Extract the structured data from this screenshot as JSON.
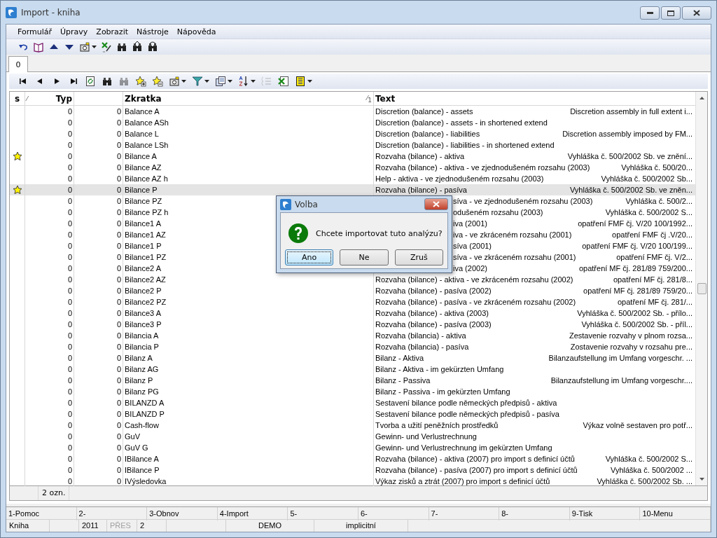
{
  "window": {
    "title": "Import - kniha"
  },
  "menu": [
    "Formulář",
    "Úpravy",
    "Zobrazit",
    "Nástroje",
    "Nápověda"
  ],
  "toolbar": [
    {
      "kind": "undo"
    },
    {
      "kind": "book"
    },
    {
      "kind": "up"
    },
    {
      "kind": "down"
    },
    {
      "kind": "camera",
      "dropdown": true
    },
    {
      "kind": "excel-pen"
    },
    {
      "kind": "binoculars"
    },
    {
      "kind": "binoculars-up"
    },
    {
      "kind": "binoculars-down"
    }
  ],
  "tabs": [
    {
      "label": "0",
      "selected": true
    }
  ],
  "grid_toolbar": [
    {
      "kind": "first"
    },
    {
      "kind": "prev"
    },
    {
      "kind": "next"
    },
    {
      "kind": "last"
    },
    {
      "kind": "refresh"
    },
    {
      "kind": "binoculars"
    },
    {
      "kind": "binoculars",
      "disabled": true
    },
    {
      "kind": "star-plus"
    },
    {
      "kind": "star-minus"
    },
    {
      "kind": "camera",
      "dropdown": true
    },
    {
      "kind": "filter",
      "dropdown": true
    },
    {
      "kind": "copy",
      "dropdown": true
    },
    {
      "kind": "sort",
      "dropdown": true
    },
    {
      "kind": "list",
      "disabled": true
    },
    {
      "kind": "excel"
    },
    {
      "kind": "table",
      "dropdown": true
    }
  ],
  "table": {
    "columns": [
      {
        "label": "s"
      },
      {
        "label": "Typ",
        "sort_mark": "⁄"
      },
      {},
      {
        "label": "Zkratka",
        "sort_mark": "⁄",
        "sort_index": "1"
      },
      {
        "label": "Text"
      }
    ],
    "rows": [
      {
        "marked": false,
        "selected": false,
        "typ": "0",
        "column_3": "0",
        "zkratka": "Balance A",
        "text": "Discretion (balance) - assets",
        "note": "Discretion assembly in full extent i..."
      },
      {
        "marked": false,
        "selected": false,
        "typ": "0",
        "column_3": "0",
        "zkratka": "Balance ASh",
        "text": "Discretion (balance) - assets - in shortened extend"
      },
      {
        "marked": false,
        "selected": false,
        "typ": "0",
        "column_3": "0",
        "zkratka": "Balance L",
        "text": "Discretion (balance) - liabilities",
        "note": "Discretion assembly imposed by FM..."
      },
      {
        "marked": false,
        "selected": false,
        "typ": "0",
        "column_3": "0",
        "zkratka": "Balance LSh",
        "text": "Discretion (balance) - liabilities - in shortened extend"
      },
      {
        "marked": true,
        "selected": false,
        "typ": "0",
        "column_3": "0",
        "zkratka": "Bilance A",
        "text": "Rozvaha (bilance) - aktiva",
        "note": "Vyhláška č. 500/2002 Sb. ve znění..."
      },
      {
        "marked": false,
        "selected": false,
        "typ": "0",
        "column_3": "0",
        "zkratka": "Bilance AZ",
        "text": "Rozvaha (bilance) - aktiva - ve zjednodušeném rozsahu (2003)",
        "note": "Vyhláška č. 500/20..."
      },
      {
        "marked": false,
        "selected": false,
        "typ": "0",
        "column_3": "0",
        "zkratka": "Bilance AZ h",
        "text": "Help - aktiva - ve zjednodušeném rozsahu (2003)",
        "note": "Vyhláška č. 500/2002 Sb..."
      },
      {
        "marked": true,
        "selected": true,
        "typ": "0",
        "column_3": "0",
        "zkratka": "Bilance P",
        "text": "Rozvaha (bilance) - pasíva",
        "note": "Vyhláška č. 500/2002 Sb. ve zněn..."
      },
      {
        "marked": false,
        "selected": false,
        "covered": true,
        "typ": "0",
        "column_3": "0",
        "zkratka": "Bilance PZ",
        "text": "síva - ve zjednodušeném rozsahu (2003)",
        "note": "Vyhláška č. 500/2..."
      },
      {
        "marked": false,
        "selected": false,
        "covered": true,
        "typ": "0",
        "column_3": "0",
        "zkratka": "Bilance PZ h",
        "text": "odušeném rozsahu (2003)",
        "note": "Vyhláška č. 500/2002 S..."
      },
      {
        "marked": false,
        "selected": false,
        "covered": true,
        "typ": "0",
        "column_3": "0",
        "zkratka": "Bilance1 A",
        "text": "iva (2001)",
        "note": "opatření FMF čj. V/20 100/1992..."
      },
      {
        "marked": false,
        "selected": false,
        "covered": true,
        "typ": "0",
        "column_3": "0",
        "zkratka": "Bilance1 AZ",
        "text": "iva - ve zkráceném rozsahu (2001)",
        "note": "opatření FMF čj .V/20..."
      },
      {
        "marked": false,
        "selected": false,
        "covered": true,
        "typ": "0",
        "column_3": "0",
        "zkratka": "Bilance1 P",
        "text": "síva (2001)",
        "note": "opatření FMF čj. V/20 100/199..."
      },
      {
        "marked": false,
        "selected": false,
        "covered": true,
        "typ": "0",
        "column_3": "0",
        "zkratka": "Bilance1 PZ",
        "text": "síva - ve zkráceném rozsahu (2001)",
        "note": "opatření FMF čj. V/2..."
      },
      {
        "marked": false,
        "selected": false,
        "covered": true,
        "typ": "0",
        "column_3": "0",
        "zkratka": "Bilance2 A",
        "text": "iva (2002)",
        "note": "opatření MF čj. 281/89 759/200..."
      },
      {
        "marked": false,
        "selected": false,
        "typ": "0",
        "column_3": "0",
        "zkratka": "Bilance2 AZ",
        "text": "Rozvaha (bilance) - aktiva - ve zkráceném rozsahu (2002)",
        "note": "opatření MF čj. 281/8..."
      },
      {
        "marked": false,
        "selected": false,
        "typ": "0",
        "column_3": "0",
        "zkratka": "Bilance2 P",
        "text": "Rozvaha (bilance) - pasíva (2002)",
        "note": "opatření MF čj. 281/89 759/20..."
      },
      {
        "marked": false,
        "selected": false,
        "typ": "0",
        "column_3": "0",
        "zkratka": "Bilance2 PZ",
        "text": "Rozvaha (bilance) - pasíva - ve zkráceném rozsahu (2002)",
        "note": "opatření MF čj. 281/..."
      },
      {
        "marked": false,
        "selected": false,
        "typ": "0",
        "column_3": "0",
        "zkratka": "Bilance3 A",
        "text": "Rozvaha (bilance) - aktiva (2003)",
        "note": "Vyhláška č. 500/2002 Sb. - přílo..."
      },
      {
        "marked": false,
        "selected": false,
        "typ": "0",
        "column_3": "0",
        "zkratka": "Bilance3 P",
        "text": "Rozvaha (bilance) - pasíva (2003)",
        "note": "Vyhláška č. 500/2002 Sb. - příl..."
      },
      {
        "marked": false,
        "selected": false,
        "typ": "0",
        "column_3": "0",
        "zkratka": "Bilancia A",
        "text": "Rozvaha (bilancia) - aktiva",
        "note": "Zestavenie rozvahy v plnom rozsa..."
      },
      {
        "marked": false,
        "selected": false,
        "typ": "0",
        "column_3": "0",
        "zkratka": "Bilancia P",
        "text": "Rozvaha (bilancia) - pasíva",
        "note": "Zostavenie rozvahy v rozsahu pre..."
      },
      {
        "marked": false,
        "selected": false,
        "typ": "0",
        "column_3": "0",
        "zkratka": "Bilanz A",
        "text": "Bilanz - Aktiva",
        "note": "Bilanzaufstellung im Umfang vorgeschr. ..."
      },
      {
        "marked": false,
        "selected": false,
        "typ": "0",
        "column_3": "0",
        "zkratka": "Bilanz AG",
        "text": "Bilanz - Aktiva - im gekürzten Umfang"
      },
      {
        "marked": false,
        "selected": false,
        "typ": "0",
        "column_3": "0",
        "zkratka": "Bilanz P",
        "text": "Bilanz - Passiva",
        "note": "Bilanzaufstellung im Umfang vorgeschr...."
      },
      {
        "marked": false,
        "selected": false,
        "typ": "0",
        "column_3": "0",
        "zkratka": "Bilanz PG",
        "text": "Bilanz - Passiva - im gekürzten Umfang"
      },
      {
        "marked": false,
        "selected": false,
        "typ": "0",
        "column_3": "0",
        "zkratka": "BILANZD A",
        "text": "Sestavení bilance podle německých předpisů - aktiva"
      },
      {
        "marked": false,
        "selected": false,
        "typ": "0",
        "column_3": "0",
        "zkratka": "BILANZD P",
        "text": "Sestavení bilance podle německých předpisů - pasíva"
      },
      {
        "marked": false,
        "selected": false,
        "typ": "0",
        "column_3": "0",
        "zkratka": "Cash-flow",
        "text": "Tvorba a užití peněžních prostředků",
        "note": "Výkaz volně sestaven pro potř..."
      },
      {
        "marked": false,
        "selected": false,
        "typ": "0",
        "column_3": "0",
        "zkratka": "GuV",
        "text": "Gewinn- und Verlustrechnung"
      },
      {
        "marked": false,
        "selected": false,
        "typ": "0",
        "column_3": "0",
        "zkratka": "GuV G",
        "text": "Gewinn- und Verlustrechnung im gekürzten Umfang"
      },
      {
        "marked": false,
        "selected": false,
        "typ": "0",
        "column_3": "0",
        "zkratka": "IBilance A",
        "text": "Rozvaha (bilance) - aktiva (2007) pro import s definicí účtů",
        "note": "Vyhláška č. 500/2002 S..."
      },
      {
        "marked": false,
        "selected": false,
        "typ": "0",
        "column_3": "0",
        "zkratka": "IBilance P",
        "text": "Rozvaha (bilance) - pasíva (2007) pro import s definicí účtů",
        "note": "Vyhláška č. 500/2002 ..."
      },
      {
        "marked": false,
        "selected": false,
        "typ": "0",
        "column_3": "0",
        "zkratka": "IVýsledovka",
        "text": "Výkaz zisků a ztrát (2007) pro import s definicí účtů",
        "note": "Vyhláška č. 500/2002 Sb. ..."
      }
    ]
  },
  "selection_count": "2 ozn.",
  "function_keys": [
    "1-Pomoc",
    "2-",
    "3-Obnov",
    "4-Import",
    "5-",
    "6-",
    "7-",
    "8-",
    "9-Tisk",
    "10-Menu"
  ],
  "status_bar": [
    {
      "text": "Kniha",
      "disabled": false
    },
    {
      "text": "2011",
      "disabled": false
    },
    {
      "text": "PŘES",
      "disabled": true
    },
    {
      "text": "2",
      "disabled": false
    },
    {
      "text": "DEMO",
      "disabled": false
    },
    {
      "text": "implicitní",
      "disabled": false
    }
  ],
  "dialog": {
    "title": "Volba",
    "message": "Chcete importovat tuto analýzu?",
    "buttons": [
      {
        "label": "Ano",
        "default": true
      },
      {
        "label": "Ne",
        "default": false
      },
      {
        "label": "Zruš",
        "default": false
      }
    ]
  }
}
